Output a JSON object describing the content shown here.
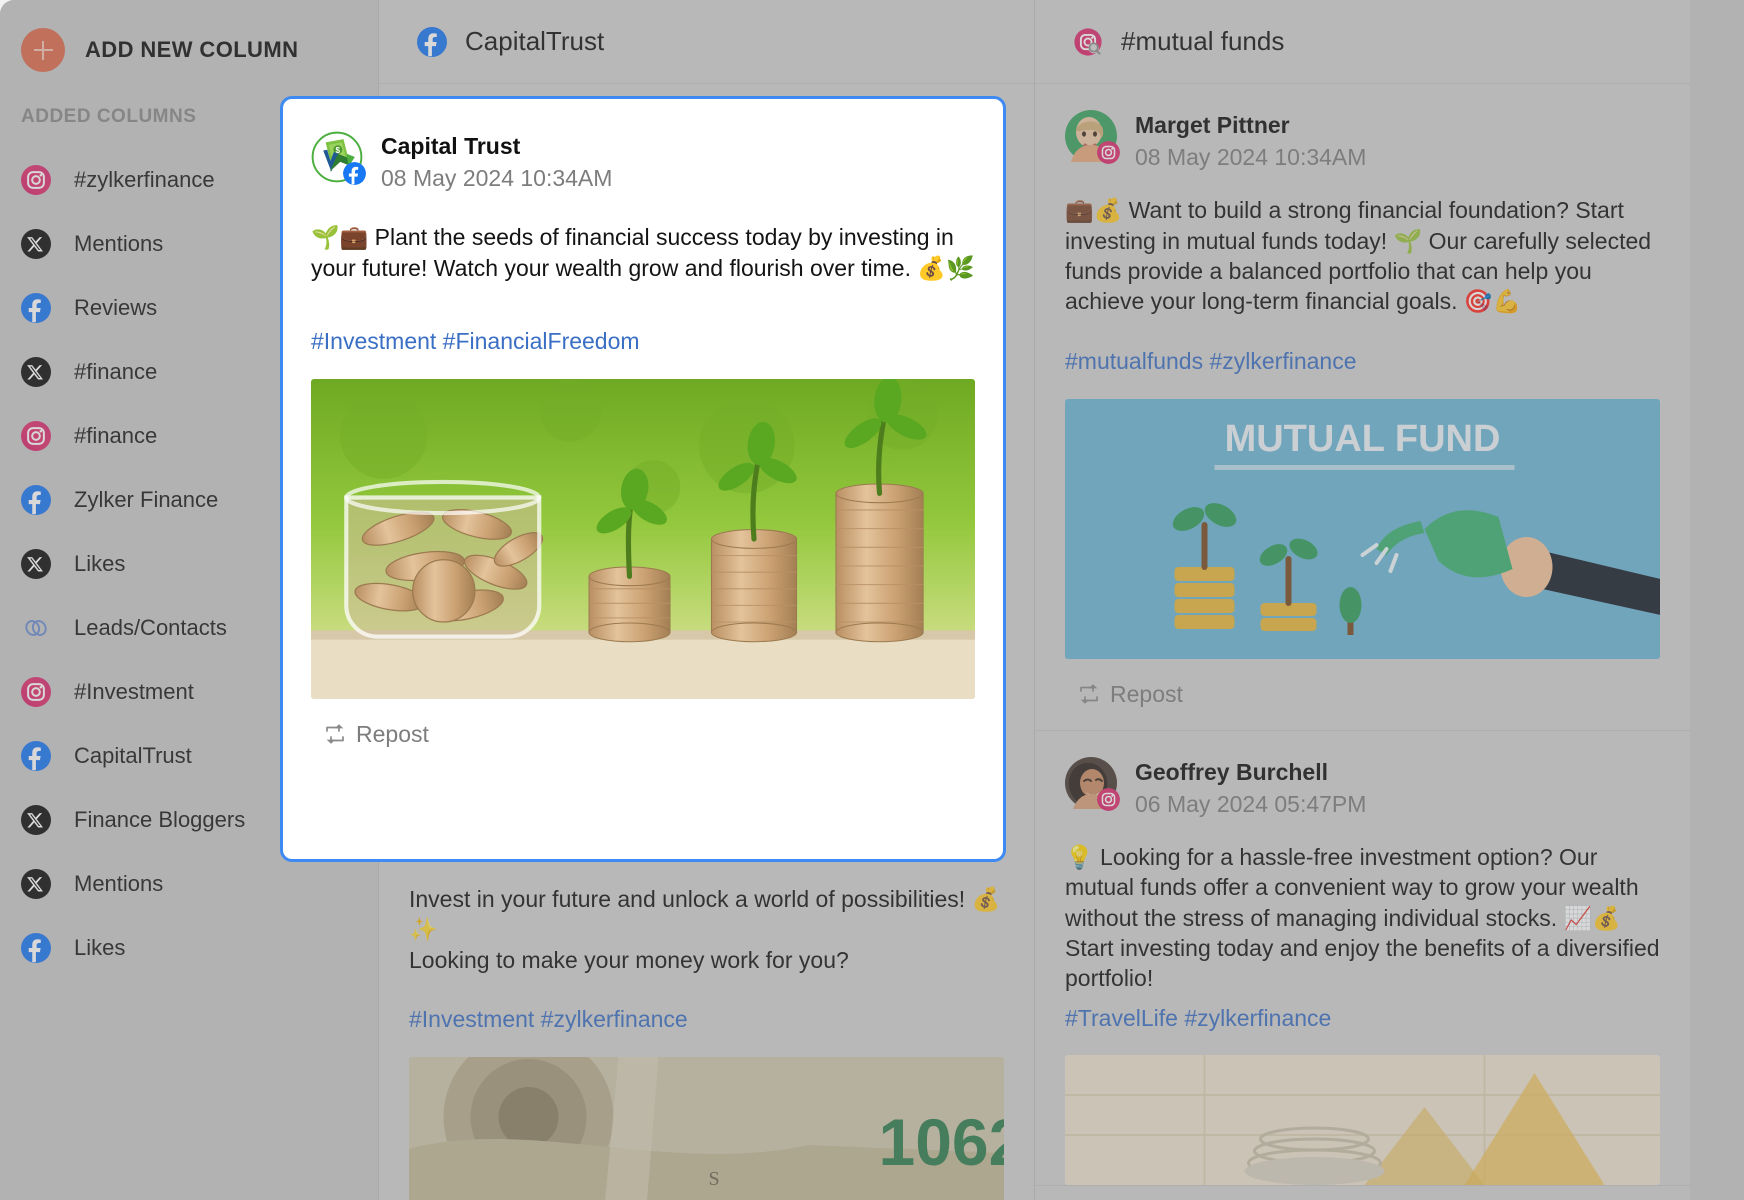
{
  "sidebar": {
    "add_new_column": "ADD NEW COLUMN",
    "added_columns_label": "ADDED COLUMNS",
    "items": [
      {
        "label": "#zylkerfinance",
        "icon": "instagram-icon"
      },
      {
        "label": "Mentions",
        "icon": "x-icon"
      },
      {
        "label": "Reviews",
        "icon": "facebook-icon"
      },
      {
        "label": "#finance",
        "icon": "x-icon"
      },
      {
        "label": "#finance",
        "icon": "instagram-icon"
      },
      {
        "label": "Zylker Finance",
        "icon": "facebook-icon"
      },
      {
        "label": "Likes",
        "icon": "x-icon"
      },
      {
        "label": "Leads/Contacts",
        "icon": "link-icon"
      },
      {
        "label": "#Investment",
        "icon": "instagram-icon"
      },
      {
        "label": "CapitalTrust",
        "icon": "facebook-icon"
      },
      {
        "label": "Finance Bloggers",
        "icon": "x-icon"
      },
      {
        "label": "Mentions",
        "icon": "x-icon"
      },
      {
        "label": "Likes",
        "icon": "facebook-icon"
      }
    ]
  },
  "columns": [
    {
      "title": "CapitalTrust",
      "icon": "facebook-icon",
      "posts": [
        {
          "text": "Invest in your future and unlock a world of possibilities! 💰✨\nLooking to make your money work for you?",
          "tags": "#Investment #zylkerfinance",
          "media": "cash-10629"
        }
      ]
    },
    {
      "title": "#mutual funds",
      "icon": "instagram-search-icon",
      "posts": [
        {
          "author": "Marget Pittner",
          "time": "08 May 2024 10:34AM",
          "badge": "instagram-icon",
          "text": "💼💰 Want to build a strong financial foundation? Start investing in mutual funds today! 🌱 Our carefully selected funds provide a balanced portfolio that can help you achieve your long-term financial goals. 🎯💪",
          "tags": "#mutualfunds #zylkerfinance",
          "media": "mutual-fund-banner",
          "media_caption": "MUTUAL FUND",
          "repost_label": "Repost"
        },
        {
          "author": "Geoffrey Burchell",
          "time": "06 May 2024 05:47PM",
          "badge": "instagram-icon",
          "text": "💡 Looking for a hassle-free investment option? Our mutual funds offer a convenient way to grow your wealth without the stress of managing individual stocks. 📈💰 Start investing today and enjoy the benefits of a diversified portfolio!",
          "tags": "#TravelLife #zylkerfinance",
          "media": "growth-chart",
          "repost_label": "Repost"
        }
      ]
    }
  ],
  "modal": {
    "author": "Capital Trust",
    "time": "08 May 2024 10:34AM",
    "badge": "facebook-icon",
    "avatar": "capital-trust-logo",
    "text": "🌱💼 Plant the seeds of financial success today by investing in your future! Watch your wealth grow and flourish over time. 💰🌿",
    "tags": "#Investment #FinancialFreedom",
    "media": "coins-plants-photo",
    "repost_label": "Repost"
  },
  "colors": {
    "accent_orange": "#dd6b4d",
    "link_blue": "#3a6fc4",
    "modal_border": "#3d8bf2",
    "facebook": "#1877f2",
    "instagram": "#e1306c",
    "x": "#111111",
    "app_bg": "#c9c9c9",
    "column_bg": "#d2d2d2"
  }
}
